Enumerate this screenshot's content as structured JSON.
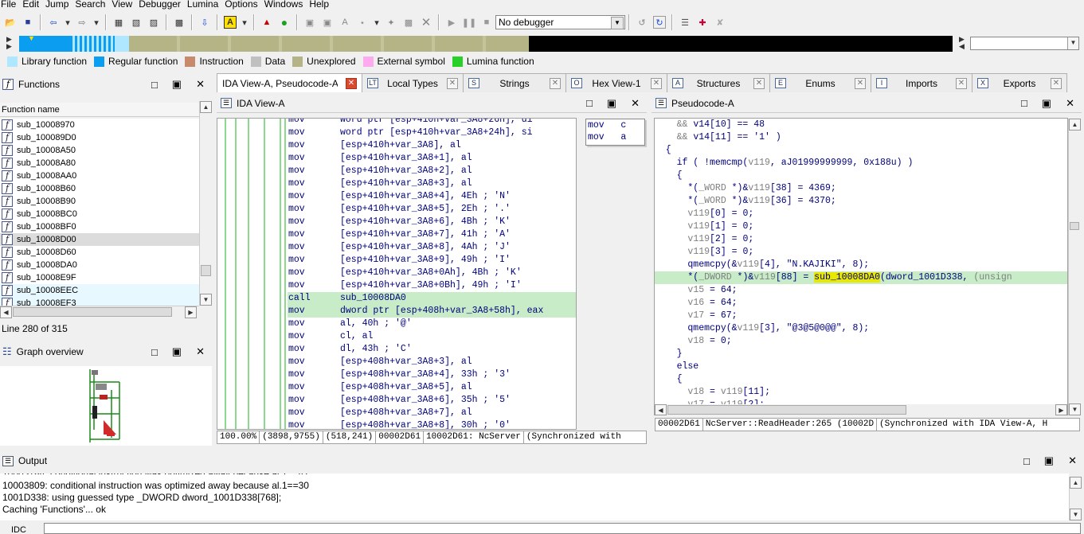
{
  "menu": [
    "File",
    "Edit",
    "Jump",
    "Search",
    "View",
    "Debugger",
    "Lumina",
    "Options",
    "Windows",
    "Help"
  ],
  "toolbar": {
    "debugger_select": "No debugger"
  },
  "legend": [
    {
      "label": "Library function",
      "color": "#aee7ff"
    },
    {
      "label": "Regular function",
      "color": "#0b9ef0"
    },
    {
      "label": "Instruction",
      "color": "#c88a6c"
    },
    {
      "label": "Data",
      "color": "#c0c0c0"
    },
    {
      "label": "Unexplored",
      "color": "#b5b487"
    },
    {
      "label": "External symbol",
      "color": "#ffa9ee"
    },
    {
      "label": "Lumina function",
      "color": "#28d028"
    }
  ],
  "functions": {
    "title": "Functions",
    "column": "Function name",
    "items": [
      "sub_10008970",
      "sub_100089D0",
      "sub_10008A50",
      "sub_10008A80",
      "sub_10008AA0",
      "sub_10008B60",
      "sub_10008B90",
      "sub_10008BC0",
      "sub_10008BF0",
      "sub_10008D00",
      "sub_10008D60",
      "sub_10008DA0",
      "sub_10008E9F",
      "sub_10008EEC",
      "sub_10008EF3"
    ],
    "status": "Line 280 of 315"
  },
  "graph": {
    "title": "Graph overview"
  },
  "tabs": [
    {
      "label": "IDA View-A, Pseudocode-A",
      "icon": "",
      "active": true
    },
    {
      "label": "Local Types",
      "icon": "LT"
    },
    {
      "label": "Strings",
      "icon": "S"
    },
    {
      "label": "Hex View-1",
      "icon": "O"
    },
    {
      "label": "Structures",
      "icon": "A"
    },
    {
      "label": "Enums",
      "icon": "E"
    },
    {
      "label": "Imports",
      "icon": "I"
    },
    {
      "label": "Exports",
      "icon": "X"
    }
  ],
  "ida_view": {
    "title": "IDA View-A",
    "lines": [
      {
        "m": "mov",
        "o": "word ptr [esp+410h+var_3A8+26h], di"
      },
      {
        "m": "mov",
        "o": "word ptr [esp+410h+var_3A8+24h], si"
      },
      {
        "m": "mov",
        "o": "[esp+410h+var_3A8], al"
      },
      {
        "m": "mov",
        "o": "[esp+410h+var_3A8+1], al"
      },
      {
        "m": "mov",
        "o": "[esp+410h+var_3A8+2], al"
      },
      {
        "m": "mov",
        "o": "[esp+410h+var_3A8+3], al"
      },
      {
        "m": "mov",
        "o": "[esp+410h+var_3A8+4], 4Eh ; 'N'"
      },
      {
        "m": "mov",
        "o": "[esp+410h+var_3A8+5], 2Eh ; '.'"
      },
      {
        "m": "mov",
        "o": "[esp+410h+var_3A8+6], 4Bh ; 'K'"
      },
      {
        "m": "mov",
        "o": "[esp+410h+var_3A8+7], 41h ; 'A'"
      },
      {
        "m": "mov",
        "o": "[esp+410h+var_3A8+8], 4Ah ; 'J'"
      },
      {
        "m": "mov",
        "o": "[esp+410h+var_3A8+9], 49h ; 'I'"
      },
      {
        "m": "mov",
        "o": "[esp+410h+var_3A8+0Ah], 4Bh ; 'K'"
      },
      {
        "m": "mov",
        "o": "[esp+410h+var_3A8+0Bh], 49h ; 'I'"
      },
      {
        "m": "call",
        "o": "sub_10008DA0"
      },
      {
        "m": "mov",
        "o": "dword ptr [esp+408h+var_3A8+58h], eax"
      },
      {
        "m": "mov",
        "o": "al, 40h ; '@'"
      },
      {
        "m": "mov",
        "o": "cl, al"
      },
      {
        "m": "mov",
        "o": "dl, 43h ; 'C'"
      },
      {
        "m": "mov",
        "o": "[esp+408h+var_3A8+3], al"
      },
      {
        "m": "mov",
        "o": "[esp+408h+var_3A8+4], 33h ; '3'"
      },
      {
        "m": "mov",
        "o": "[esp+408h+var_3A8+5], al"
      },
      {
        "m": "mov",
        "o": "[esp+408h+var_3A8+6], 35h ; '5'"
      },
      {
        "m": "mov",
        "o": "[esp+408h+var_3A8+7], al"
      },
      {
        "m": "mov",
        "o": "[esp+408h+var_3A8+8], 30h ; '0'"
      }
    ],
    "side_lines": [
      "mov   c",
      "mov   a"
    ],
    "status": [
      "100.00%",
      "(3898,9755)",
      "(518,241)",
      "00002D61",
      "10002D61: NcServer",
      "(Synchronized with"
    ]
  },
  "pseudocode": {
    "title": "Pseudocode-A",
    "status": [
      "00002D61",
      "NcServer::ReadHeader:265 (10002D",
      "(Synchronized with IDA View-A, H"
    ]
  },
  "output": {
    "title": "Output",
    "lines": [
      "10003809: conditional instruction was optimized away because al.1==30",
      "1001D338: using guessed type _DWORD dword_1001D338[768];",
      "Caching 'Functions'... ok"
    ],
    "prompt": "IDC"
  }
}
